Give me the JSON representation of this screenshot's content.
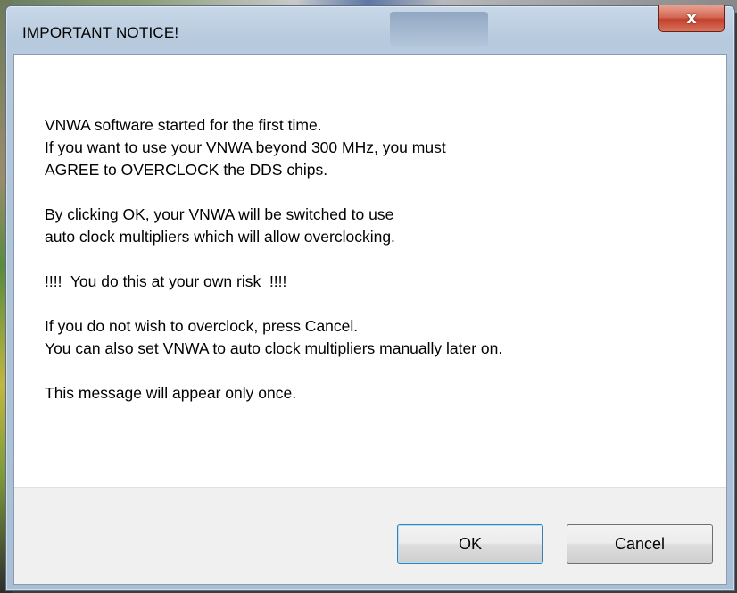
{
  "window": {
    "title": "IMPORTANT NOTICE!",
    "close_glyph": "x"
  },
  "message": {
    "lines": [
      "VNWA software started for the first time.",
      "If you want to use your VNWA beyond 300 MHz, you must",
      "AGREE to OVERCLOCK the DDS chips.",
      "",
      "By clicking OK, your VNWA will be switched to use",
      "auto clock multipliers which will allow overclocking.",
      "",
      "!!!!  You do this at your own risk  !!!!",
      "",
      "If you do not wish to overclock, press Cancel.",
      "You can also set VNWA to auto clock multipliers manually later on.",
      "",
      "This message will appear only once."
    ]
  },
  "buttons": {
    "ok_label": "OK",
    "cancel_label": "Cancel"
  },
  "icons": {
    "close": "close-icon"
  },
  "colors": {
    "close_button": "#c2412c",
    "titlebar": "#b6c9dd",
    "client_background": "#ffffff",
    "button_bar": "#f0f0f0"
  }
}
